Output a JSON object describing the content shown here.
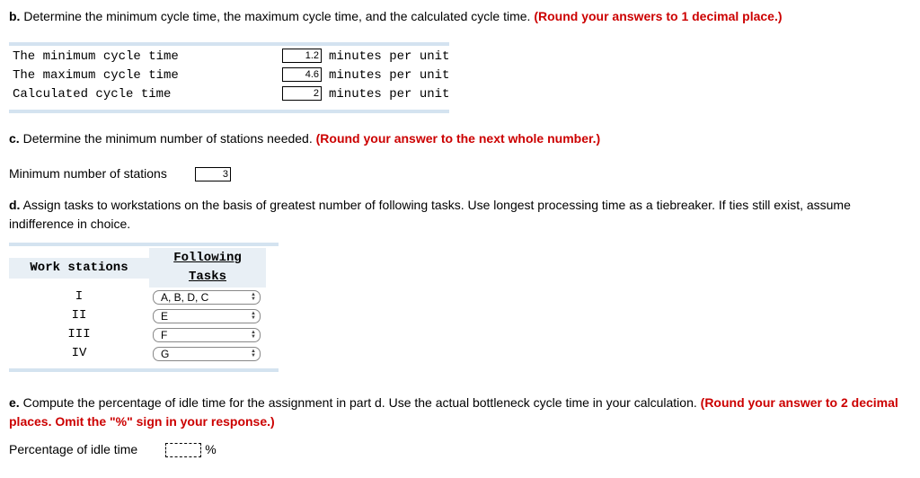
{
  "b": {
    "label": "b.",
    "text": " Determine the minimum cycle time, the maximum cycle time, and the calculated cycle time. ",
    "hint": "(Round your answers to 1 decimal place.)",
    "rows": [
      {
        "label": "The minimum cycle time",
        "value": "1.2",
        "unit": "minutes per unit"
      },
      {
        "label": "The maximum cycle time",
        "value": "4.6",
        "unit": "minutes per unit"
      },
      {
        "label": "Calculated cycle time",
        "value": "2",
        "unit": "minutes per unit"
      }
    ]
  },
  "c": {
    "label": "c.",
    "text": " Determine the minimum number of stations needed. ",
    "hint": "(Round your answer to the next whole number.)",
    "field_label": "Minimum number of stations",
    "value": "3"
  },
  "d": {
    "label": "d.",
    "text": " Assign tasks to workstations on the basis of greatest number of following tasks. Use longest processing time as a tiebreaker. If ties still exist, assume indifference in choice.",
    "headers": {
      "ws": "Work stations",
      "ft": "Following Tasks"
    },
    "rows": [
      {
        "ws": "I",
        "ft": "A, B, D, C"
      },
      {
        "ws": "II",
        "ft": "E"
      },
      {
        "ws": "III",
        "ft": "F"
      },
      {
        "ws": "IV",
        "ft": "G"
      }
    ]
  },
  "e": {
    "label": "e.",
    "text": " Compute the percentage of idle time for the assignment in part d. Use the actual bottleneck cycle time in your calculation. ",
    "hint": "(Round your answer to 2 decimal places. Omit the \"%\" sign in your response.)",
    "field_label": "Percentage of idle time",
    "value": "",
    "unit": "%"
  }
}
